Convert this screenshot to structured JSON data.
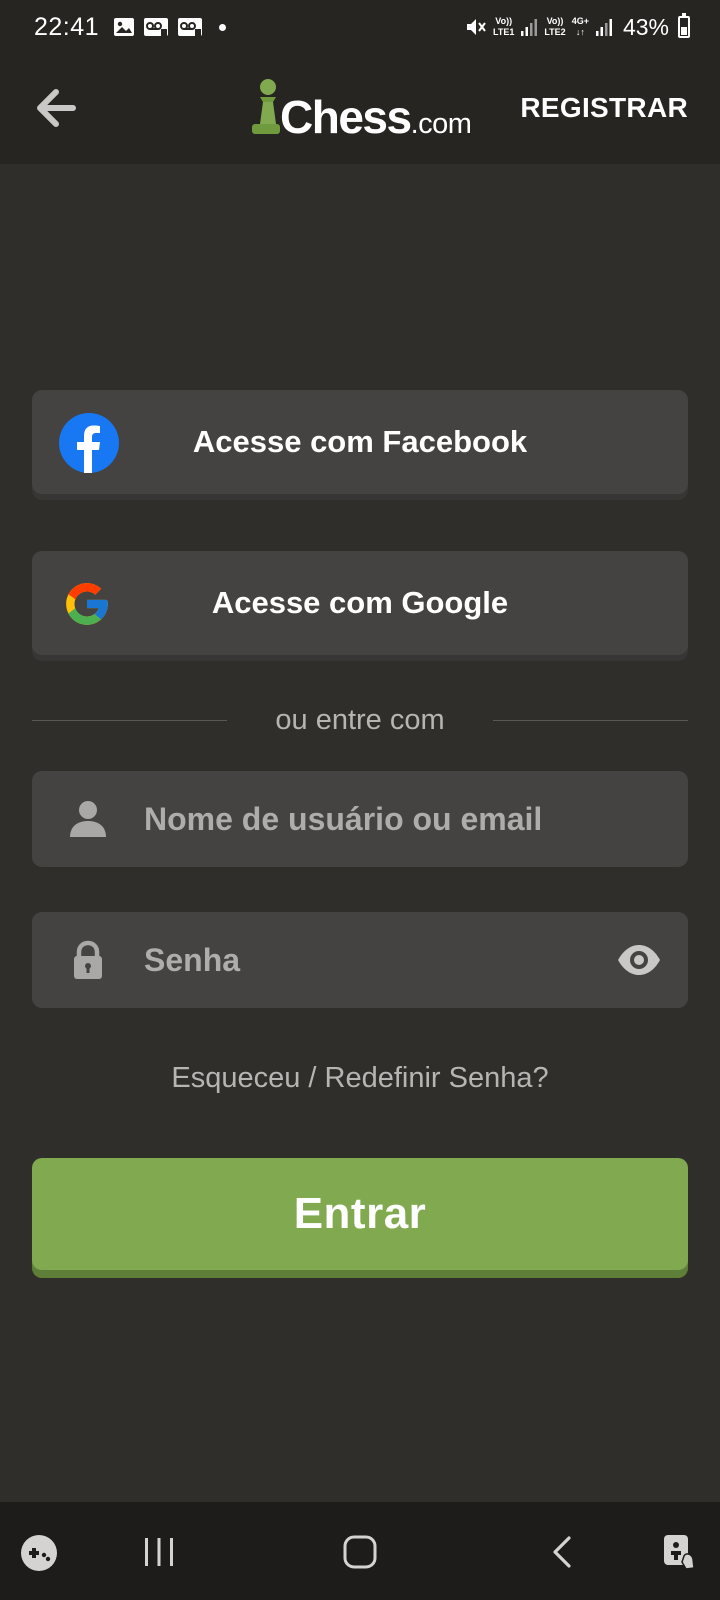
{
  "status_bar": {
    "time": "22:41",
    "network1": [
      "Vo))",
      "LTE1"
    ],
    "network2": [
      "Vo))",
      "LTE2"
    ],
    "network3": [
      "4G+",
      "↓↑"
    ],
    "battery_percent": "43%",
    "battery_level": 0.43
  },
  "header": {
    "logo_main": "Chess",
    "logo_suffix": ".com",
    "register_label": "REGISTRAR"
  },
  "social": {
    "facebook_label": "Acesse com Facebook",
    "google_label": "Acesse com Google"
  },
  "divider_text": "ou entre com",
  "form": {
    "username_placeholder": "Nome de usuário ou email",
    "password_placeholder": "Senha",
    "forgot_label": "Esqueceu / Redefinir Senha?",
    "submit_label": "Entrar"
  },
  "colors": {
    "background": "#302e2b",
    "header": "#262522",
    "button": "#454341",
    "accent_green": "#81a94f",
    "facebook_blue": "#1877f2"
  },
  "icons": {
    "back": "arrow-left-icon",
    "logo": "pawn-icon",
    "facebook": "facebook-icon",
    "google": "google-icon",
    "user": "user-icon",
    "lock": "lock-icon",
    "eye": "eye-icon",
    "nav_game": "game-launcher-icon",
    "nav_recents": "recents-icon",
    "nav_home": "home-icon",
    "nav_back": "back-icon",
    "nav_accessibility": "accessibility-icon"
  }
}
